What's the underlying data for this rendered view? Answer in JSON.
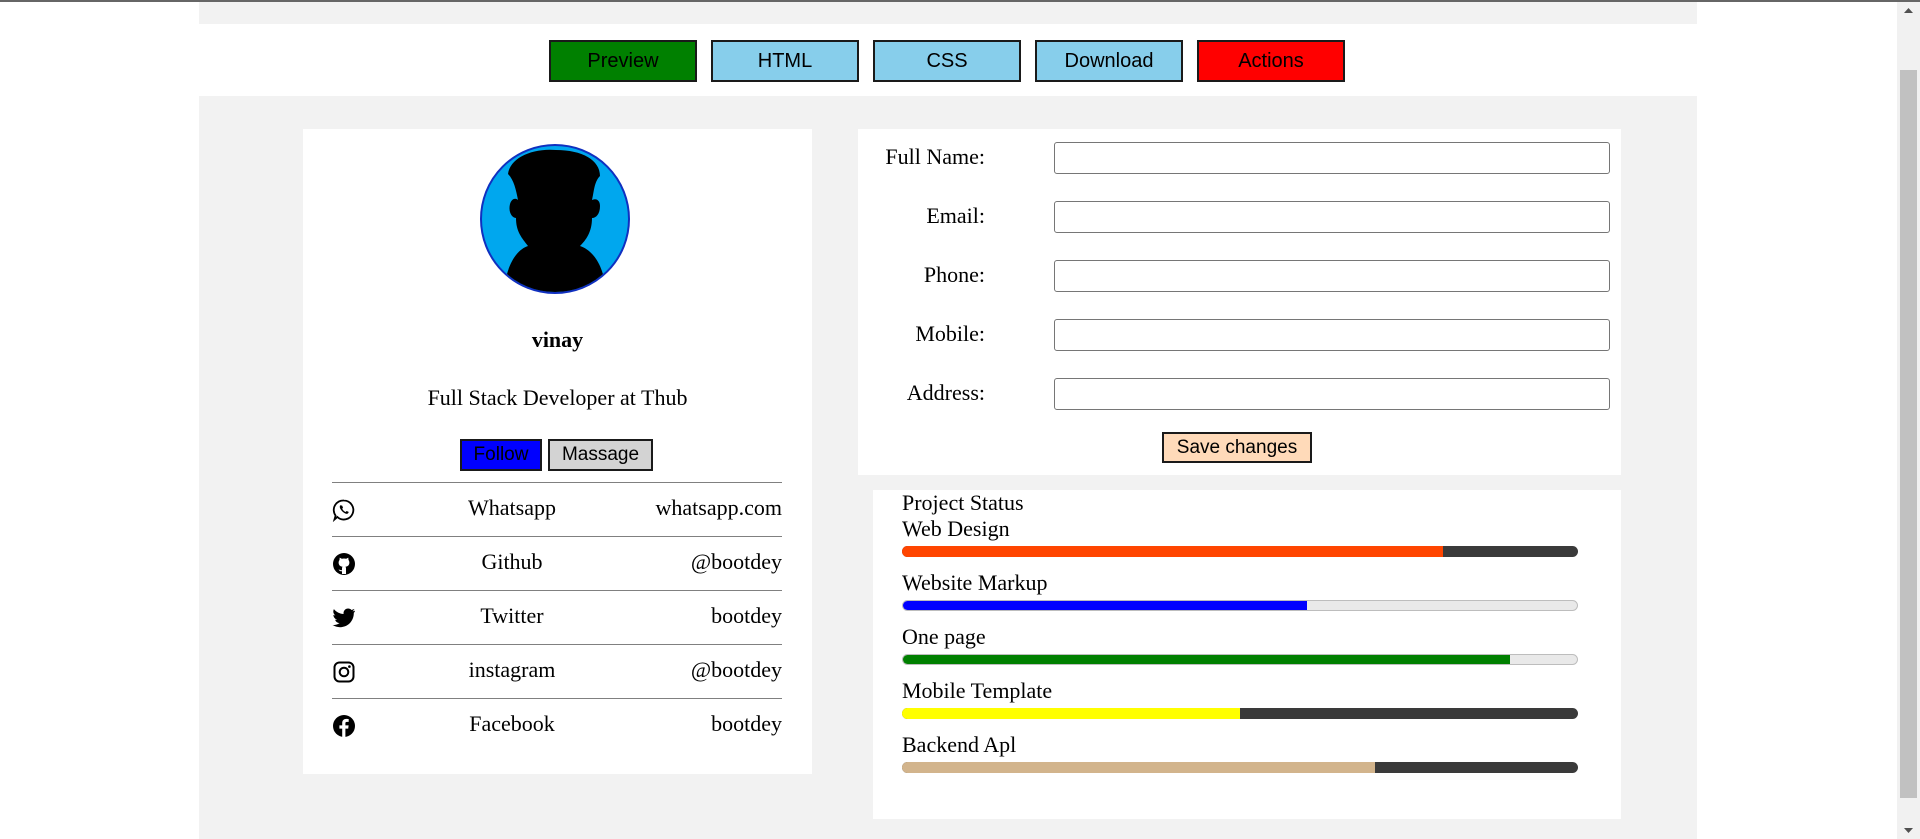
{
  "toolbar": {
    "buttons": [
      {
        "label": "Preview",
        "color": "#008000"
      },
      {
        "label": "HTML",
        "color": "#87ceeb"
      },
      {
        "label": "CSS",
        "color": "#87ceeb"
      },
      {
        "label": "Download",
        "color": "#87ceeb"
      },
      {
        "label": "Actions",
        "color": "#ff0000"
      }
    ]
  },
  "profile": {
    "avatar_icon": "user-silhouette-icon",
    "name": "vinay",
    "role": "Full Stack Developer at Thub",
    "follow_label": "Follow",
    "message_label": "Massage",
    "social": [
      {
        "icon": "whatsapp-icon",
        "name": "Whatsapp",
        "value": "whatsapp.com"
      },
      {
        "icon": "github-icon",
        "name": "Github",
        "value": "@bootdey"
      },
      {
        "icon": "twitter-icon",
        "name": "Twitter",
        "value": "bootdey"
      },
      {
        "icon": "instagram-icon",
        "name": "instagram",
        "value": "@bootdey"
      },
      {
        "icon": "facebook-icon",
        "name": "Facebook",
        "value": "bootdey"
      }
    ]
  },
  "form": {
    "fields": [
      {
        "label": "Full Name:",
        "value": ""
      },
      {
        "label": "Email:",
        "value": ""
      },
      {
        "label": "Phone:",
        "value": ""
      },
      {
        "label": "Mobile:",
        "value": ""
      },
      {
        "label": "Address:",
        "value": ""
      }
    ],
    "save_label": "Save changes"
  },
  "projects": {
    "title": "Project Status",
    "items": [
      {
        "label": "Web Design",
        "progress": 0.8,
        "color": "#ff4500",
        "track": "dark"
      },
      {
        "label": "Website Markup",
        "progress": 0.6,
        "color": "#0000ff",
        "track": "light"
      },
      {
        "label": "One page",
        "progress": 0.9,
        "color": "#008000",
        "track": "light"
      },
      {
        "label": "Mobile Template",
        "progress": 0.5,
        "color": "#ffff00",
        "track": "dark"
      },
      {
        "label": "Backend Apl",
        "progress": 0.7,
        "color": "#d2b48c",
        "track": "dark"
      }
    ]
  }
}
